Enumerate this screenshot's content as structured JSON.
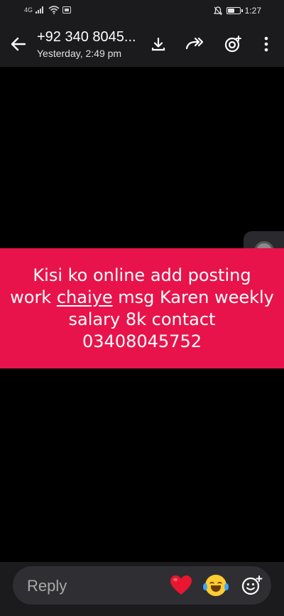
{
  "status_bar": {
    "network": "4G",
    "wifi_badge": "ⁱ",
    "time": "1:27"
  },
  "header": {
    "contact_title": "+92 340 8045...",
    "timestamp": "Yesterday, 2:49 pm",
    "icons": [
      "back-arrow-icon",
      "download-icon",
      "forward-icon",
      "add-status-camera-icon",
      "more-vert-icon"
    ]
  },
  "status_post": {
    "line1": "Kisi ko online add posting",
    "line2_pre": "work ",
    "line2_underlined": "chaiye",
    "line2_post": " msg Karen weekly",
    "line3": "salary 8k contact",
    "line4": "03408045752",
    "background_color": "#e8134a"
  },
  "reply": {
    "placeholder": "Reply",
    "reactions": [
      "heart-emoji-icon",
      "laughing-tears-emoji-icon",
      "add-emoji-icon"
    ]
  }
}
